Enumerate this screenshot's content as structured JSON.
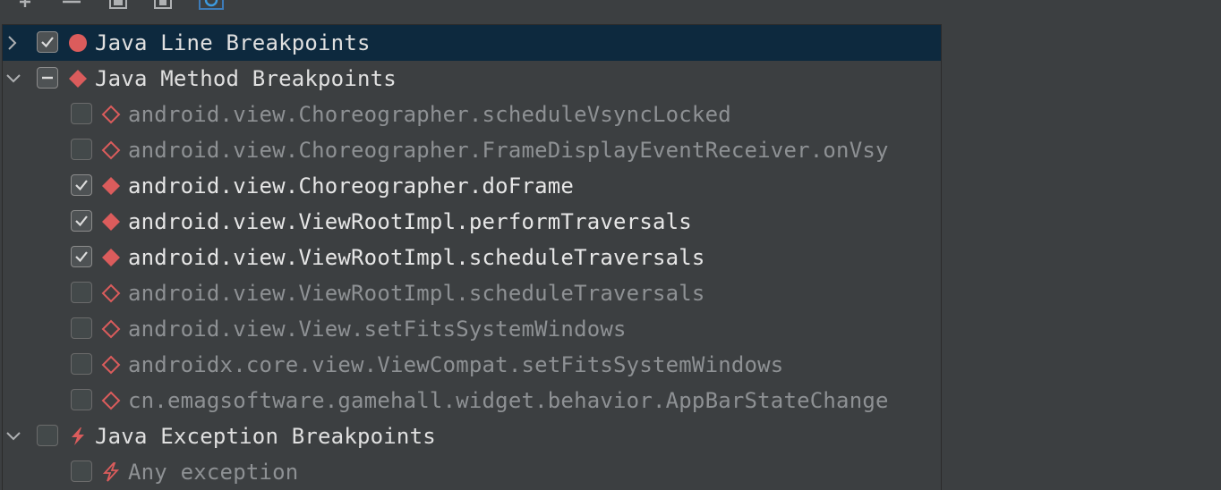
{
  "toolbar": {
    "buttons": [
      {
        "name": "add-icon",
        "glyph": "+"
      },
      {
        "name": "remove-icon",
        "glyph": "−"
      },
      {
        "name": "group-icon",
        "glyph": ""
      },
      {
        "name": "ungroup-icon",
        "glyph": ""
      },
      {
        "name": "restore-icon",
        "glyph": ""
      }
    ]
  },
  "colors": {
    "background": "#3c3f41",
    "selection": "#0d293e",
    "breakpoint_red": "#db5c5c",
    "text_enabled": "#e6e6e6",
    "text_disabled": "#8e9194"
  },
  "groups": {
    "line": {
      "label": "Java Line Breakpoints",
      "expanded": false,
      "state": "checked",
      "selected": true,
      "icon": "line-breakpoint-icon"
    },
    "method": {
      "label": "Java Method Breakpoints",
      "expanded": true,
      "state": "partial",
      "icon": "method-breakpoint-icon",
      "items": [
        {
          "label": "android.view.Choreographer.scheduleVsyncLocked",
          "checked": false
        },
        {
          "label": "android.view.Choreographer.FrameDisplayEventReceiver.onVsy",
          "checked": false
        },
        {
          "label": "android.view.Choreographer.doFrame",
          "checked": true
        },
        {
          "label": "android.view.ViewRootImpl.performTraversals",
          "checked": true
        },
        {
          "label": "android.view.ViewRootImpl.scheduleTraversals",
          "checked": true
        },
        {
          "label": "android.view.ViewRootImpl.scheduleTraversals",
          "checked": false
        },
        {
          "label": "android.view.View.setFitsSystemWindows",
          "checked": false
        },
        {
          "label": "androidx.core.view.ViewCompat.setFitsSystemWindows",
          "checked": false
        },
        {
          "label": "cn.emagsoftware.gamehall.widget.behavior.AppBarStateChange",
          "checked": false
        }
      ]
    },
    "exception": {
      "label": "Java Exception Breakpoints",
      "expanded": true,
      "state": "unchecked",
      "icon": "exception-breakpoint-icon",
      "items": [
        {
          "label": "Any exception",
          "checked": false
        }
      ]
    }
  }
}
